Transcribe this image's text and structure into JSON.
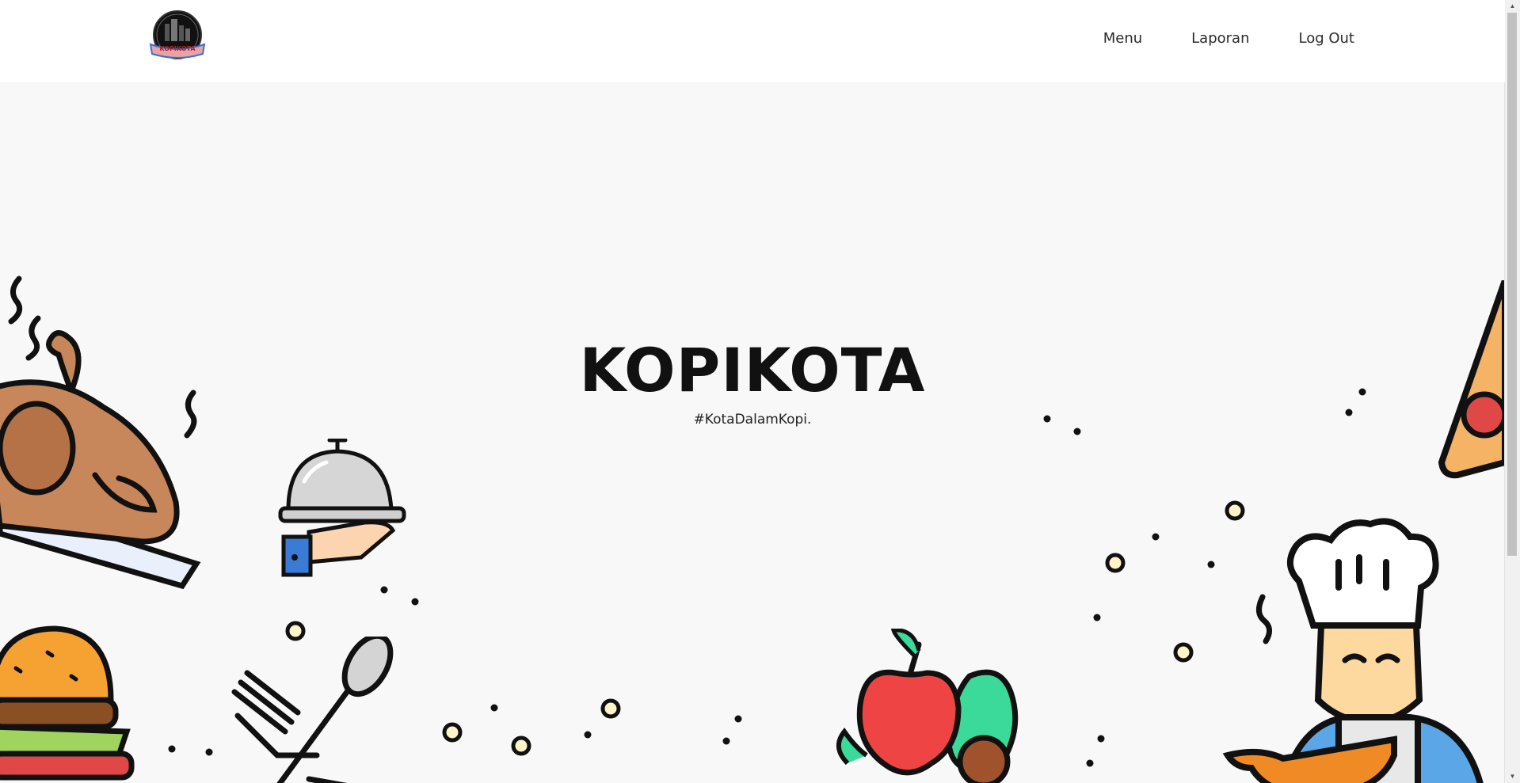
{
  "brand": {
    "logo_text": "KOPIKOTA"
  },
  "nav": {
    "items": [
      {
        "label": "Menu"
      },
      {
        "label": "Laporan"
      },
      {
        "label": "Log Out"
      }
    ]
  },
  "hero": {
    "title": "KOPIKOTA",
    "tagline": "#KotaDalamKopi."
  },
  "icons": {
    "roast_chicken": "roast-chicken-icon",
    "cloche_serving": "cloche-serving-icon",
    "burger": "burger-icon",
    "fork_spoon": "fork-spoon-icon",
    "fruits": "fruits-icon",
    "chef": "chef-icon",
    "pizza": "pizza-slice-icon"
  },
  "colors": {
    "navbar_bg": "#ffffff",
    "hero_bg": "#f8f8f8",
    "text": "#111111",
    "outline": "#111111"
  }
}
